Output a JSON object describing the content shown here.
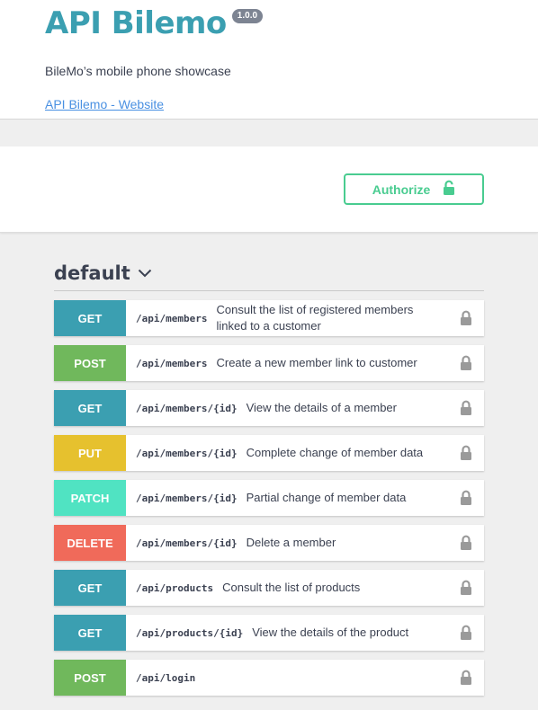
{
  "info": {
    "title": "API Bilemo",
    "version": "1.0.0",
    "description": "BileMo’s mobile phone showcase",
    "website_link": "API Bilemo - Website"
  },
  "auth": {
    "authorize_label": "Authorize",
    "icon": "unlocked-padlock-icon",
    "color": "#49cc90"
  },
  "tag": {
    "name": "default",
    "icon": "chevron-down-icon"
  },
  "method_colors": {
    "GET": "#3b9fb1",
    "POST": "#70b85c",
    "PUT": "#e6c12e",
    "PATCH": "#50e3c2",
    "DELETE": "#f06a5a"
  },
  "operations": [
    {
      "method": "GET",
      "path": "/api/members",
      "summary": "Consult the list of registered members linked to a customer"
    },
    {
      "method": "POST",
      "path": "/api/members",
      "summary": "Create a new member link to customer"
    },
    {
      "method": "GET",
      "path": "/api/members/{id}",
      "summary": "View the details of a member"
    },
    {
      "method": "PUT",
      "path": "/api/members/{id}",
      "summary": "Complete change of member data"
    },
    {
      "method": "PATCH",
      "path": "/api/members/{id}",
      "summary": "Partial change of member data"
    },
    {
      "method": "DELETE",
      "path": "/api/members/{id}",
      "summary": "Delete a member"
    },
    {
      "method": "GET",
      "path": "/api/products",
      "summary": "Consult the list of products"
    },
    {
      "method": "GET",
      "path": "/api/products/{id}",
      "summary": "View the details of the product"
    },
    {
      "method": "POST",
      "path": "/api/login",
      "summary": ""
    }
  ]
}
